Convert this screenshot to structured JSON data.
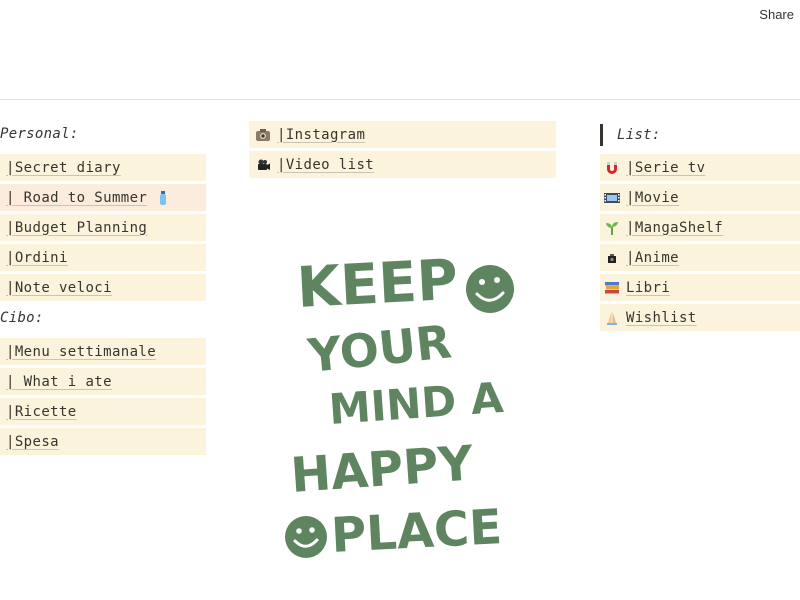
{
  "topbar": {
    "share_label": "Share"
  },
  "personal": {
    "heading": "Personal:",
    "items": [
      {
        "label": "|Secret diary"
      },
      {
        "label": "| Road to Summer"
      },
      {
        "label": "|Budget Planning"
      },
      {
        "label": "|Ordini"
      },
      {
        "label": "|Note veloci"
      }
    ]
  },
  "cibo": {
    "heading": "Cibo:",
    "items": [
      {
        "label": "|Menu settimanale"
      },
      {
        "label": "| What i ate"
      },
      {
        "label": "|Ricette"
      },
      {
        "label": "|Spesa"
      }
    ]
  },
  "social": {
    "items": [
      {
        "label": "|Instagram",
        "icon": "camera-icon"
      },
      {
        "label": "|Video list",
        "icon": "video-camera-icon"
      }
    ]
  },
  "list": {
    "heading": "List:",
    "items": [
      {
        "label": "|Serie tv",
        "icon": "magnet-icon"
      },
      {
        "label": "|Movie",
        "icon": "film-strip-icon"
      },
      {
        "label": "|MangaShelf",
        "icon": "seedling-icon"
      },
      {
        "label": "|Anime",
        "icon": "camera-box-icon"
      },
      {
        "label": "Libri",
        "icon": "books-icon"
      },
      {
        "label": "Wishlist",
        "icon": "praying-hands-icon"
      }
    ]
  },
  "poster": {
    "lines": [
      "KEEP",
      "YOUR",
      "MIND A",
      "HAPPY",
      "PLACE"
    ],
    "color": "#5e8560"
  }
}
